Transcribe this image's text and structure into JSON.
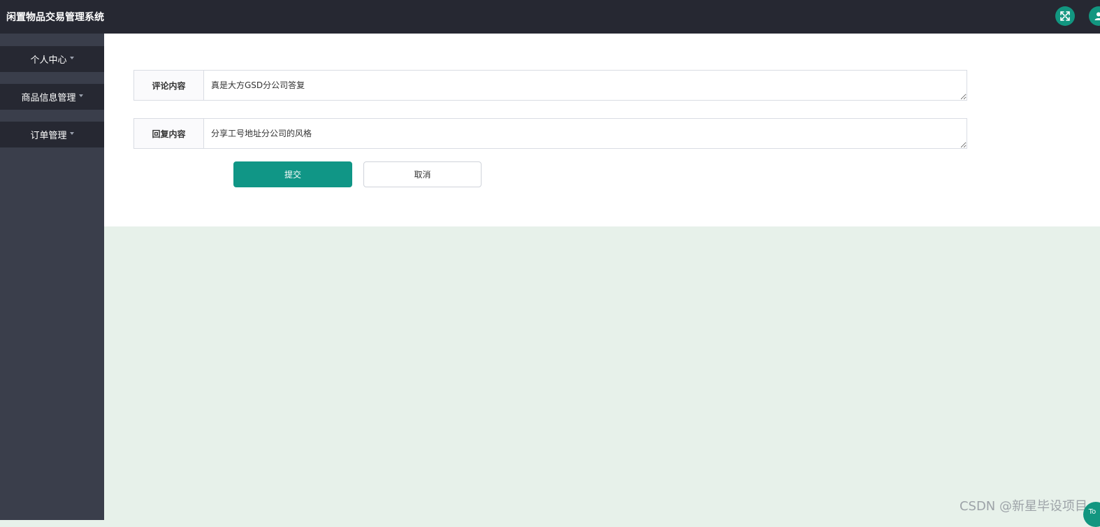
{
  "header": {
    "title": "闲置物品交易管理系统",
    "icons": [
      "fullscreen-icon",
      "user-icon"
    ],
    "background": "#262832"
  },
  "sidebar": {
    "items": [
      {
        "label": "个人中心"
      },
      {
        "label": "商品信息管理"
      },
      {
        "label": "订单管理"
      }
    ]
  },
  "form": {
    "comment_label": "评论内容",
    "comment_value": "真是大方GSD分公司答复",
    "reply_label": "回复内容",
    "reply_value": "分享工号地址分公司的风格",
    "submit_label": "提交",
    "cancel_label": "取消"
  },
  "watermark": "CSDN @新星毕设项目",
  "back_to_top_label": "To",
  "colors": {
    "accent": "#129680",
    "sidebar": "#3a3e4b",
    "page_background": "#e7f1ea"
  }
}
